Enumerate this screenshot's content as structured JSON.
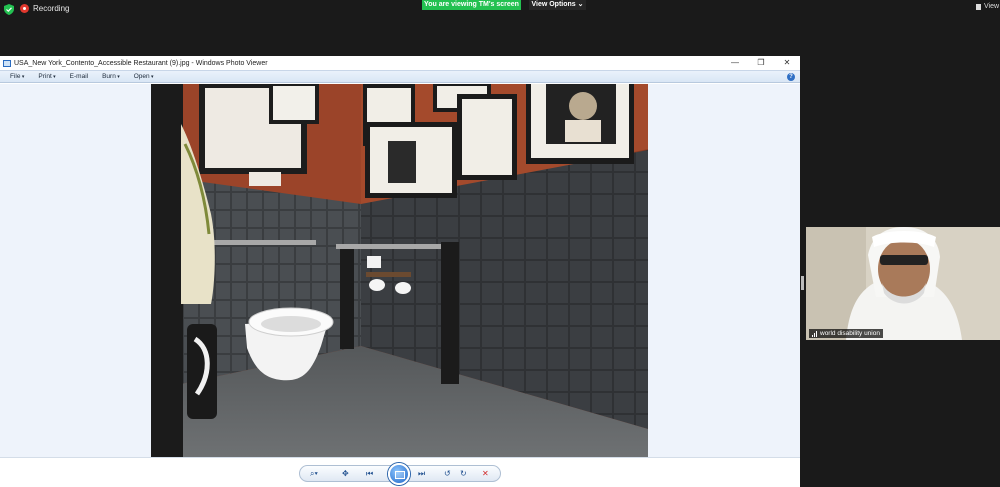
{
  "zoom": {
    "recording_label": "Recording",
    "sharing_banner": "You are viewing TM's screen",
    "view_options": "View Options",
    "view_right": "View"
  },
  "viewer": {
    "title": "USA_New York_Contento_Accessible Restaurant (9).jpg - Windows Photo Viewer",
    "menu": [
      "File",
      "Print",
      "E-mail",
      "Burn",
      "Open"
    ]
  },
  "participant": {
    "name": "world disability union"
  },
  "colors": {
    "zoom_bg": "#1a1a1a",
    "sharing_green": "#23c151",
    "recording_red": "#e0382e",
    "viewer_canvas": "#eef3fb"
  },
  "icons": {
    "security": "shield-icon",
    "zoom_tool": "magnifier-icon",
    "actual_size": "actual-size-icon",
    "previous": "previous-icon",
    "slideshow": "slideshow-icon",
    "next": "next-icon",
    "rotate_ccw": "rotate-left-icon",
    "rotate_cw": "rotate-right-icon",
    "delete": "delete-icon"
  }
}
